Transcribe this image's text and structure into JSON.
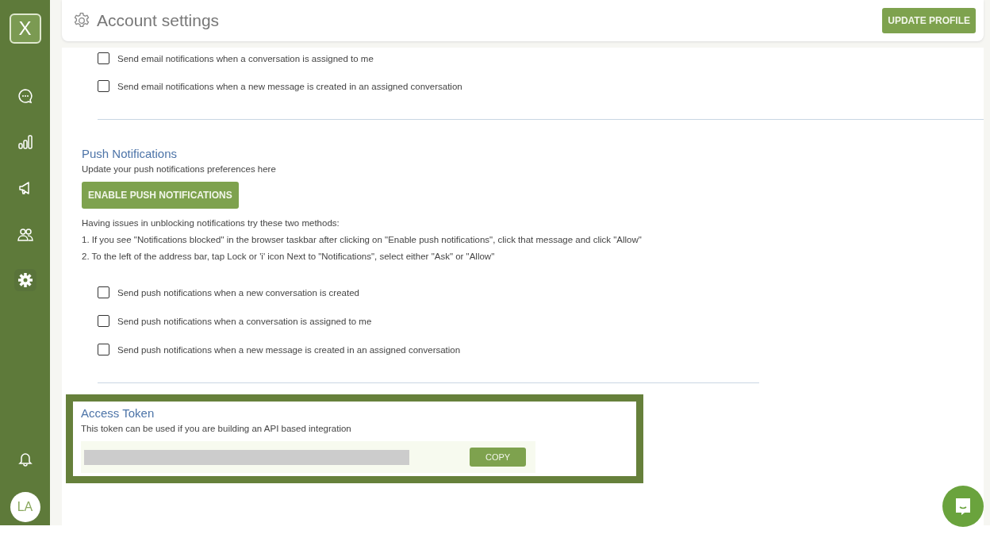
{
  "sidebar": {
    "logo": "X",
    "avatar": "LA",
    "items": [
      {
        "kind": "chat",
        "selected": false
      },
      {
        "kind": "reports",
        "selected": false
      },
      {
        "kind": "campaigns",
        "selected": false
      },
      {
        "kind": "contacts",
        "selected": false
      },
      {
        "kind": "settings",
        "selected": true
      }
    ]
  },
  "header": {
    "title": "Account settings",
    "button": "UPDATE PROFILE"
  },
  "email_options": [
    {
      "label": "Send email notifications when a conversation is assigned to me",
      "checked": false
    },
    {
      "label": "Send email notifications when a new message is created in an assigned conversation",
      "checked": false
    }
  ],
  "push": {
    "title": "Push Notifications",
    "subtitle": "Update your push notifications preferences here",
    "button": "ENABLE PUSH NOTIFICATIONS",
    "help": "Having issues in unblocking notifications try these two methods:",
    "steps": [
      "1. If you see \"Notifications blocked\" in the browser taskbar after clicking on \"Enable push notifications\", click that message and click \"Allow\"",
      "2. To the left of the address bar, tap Lock or 'i' icon Next to \"Notifications\", select either \"Ask\" or \"Allow\""
    ],
    "options": [
      {
        "label": "Send push notifications when a new conversation is created",
        "checked": false
      },
      {
        "label": "Send push notifications when a conversation is assigned to me",
        "checked": false
      },
      {
        "label": "Send push notifications when a new message is created in an assigned conversation",
        "checked": false
      }
    ]
  },
  "token": {
    "title": "Access Token",
    "subtitle": "This token can be used if you are building an API based integration",
    "button": "COPY"
  }
}
